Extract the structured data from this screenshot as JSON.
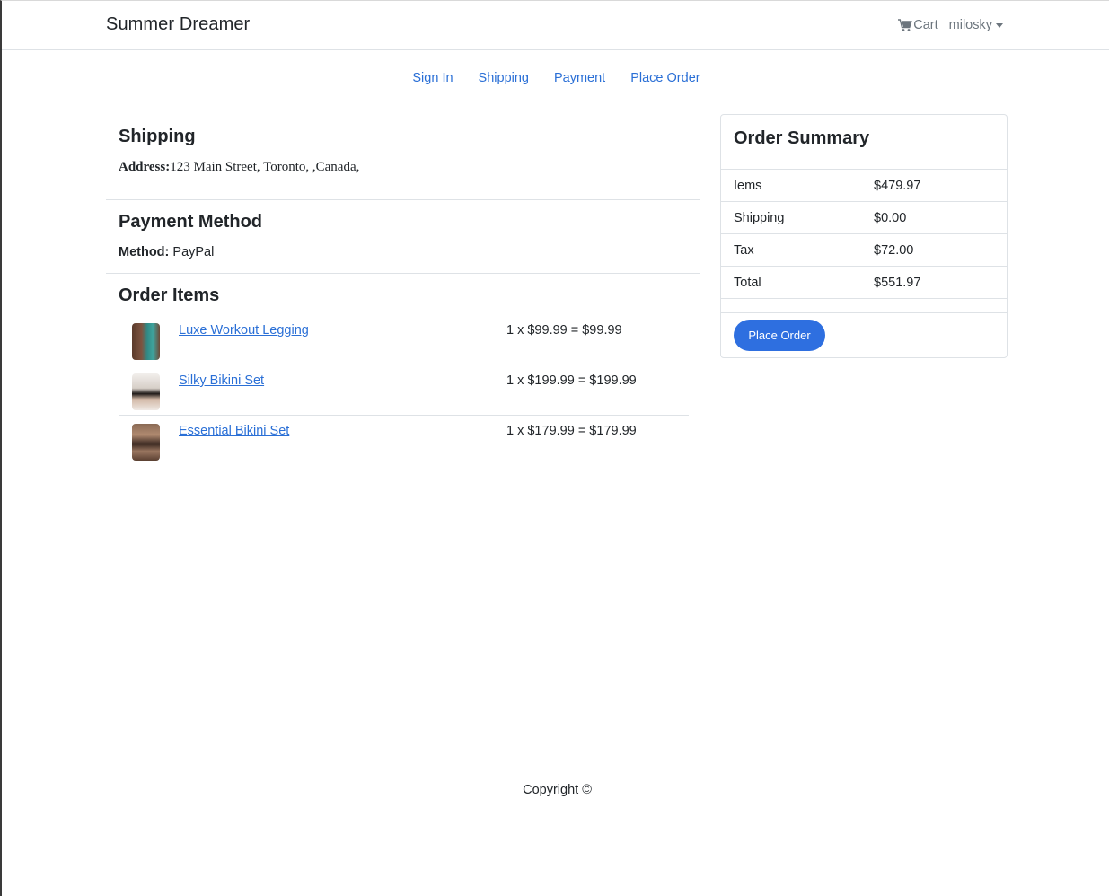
{
  "navbar": {
    "brand": "Summer Dreamer",
    "cart_label": "Cart",
    "user_label": "milosky"
  },
  "steps": [
    {
      "label": "Sign In"
    },
    {
      "label": "Shipping"
    },
    {
      "label": "Payment"
    },
    {
      "label": "Place Order"
    }
  ],
  "shipping": {
    "title": "Shipping",
    "address_label": "Address:",
    "address_value": "123 Main Street, Toronto, ,Canada,"
  },
  "payment": {
    "title": "Payment Method",
    "method_label": "Method:",
    "method_value": " PayPal"
  },
  "order_items": {
    "title": "Order Items",
    "items": [
      {
        "name": "Luxe Workout Legging",
        "price_line": "1 x $99.99 = $99.99"
      },
      {
        "name": "Silky Bikini Set",
        "price_line": "1 x $199.99 = $199.99"
      },
      {
        "name": "Essential Bikini Set",
        "price_line": "1 x $179.99 = $179.99"
      }
    ]
  },
  "summary": {
    "title": "Order Summary",
    "rows": [
      {
        "label": "Iems",
        "value": "$479.97"
      },
      {
        "label": "Shipping",
        "value": "$0.00"
      },
      {
        "label": "Tax",
        "value": "$72.00"
      },
      {
        "label": "Total",
        "value": "$551.97"
      }
    ],
    "button_label": "Place Order"
  },
  "footer": {
    "text": "Copyright ©"
  },
  "colors": {
    "link": "#2a6fd6",
    "button": "#2e6fe0",
    "border": "#dee2e6"
  },
  "icons": {
    "cart": "cart-icon",
    "user_dropdown": "caret-down-icon"
  }
}
